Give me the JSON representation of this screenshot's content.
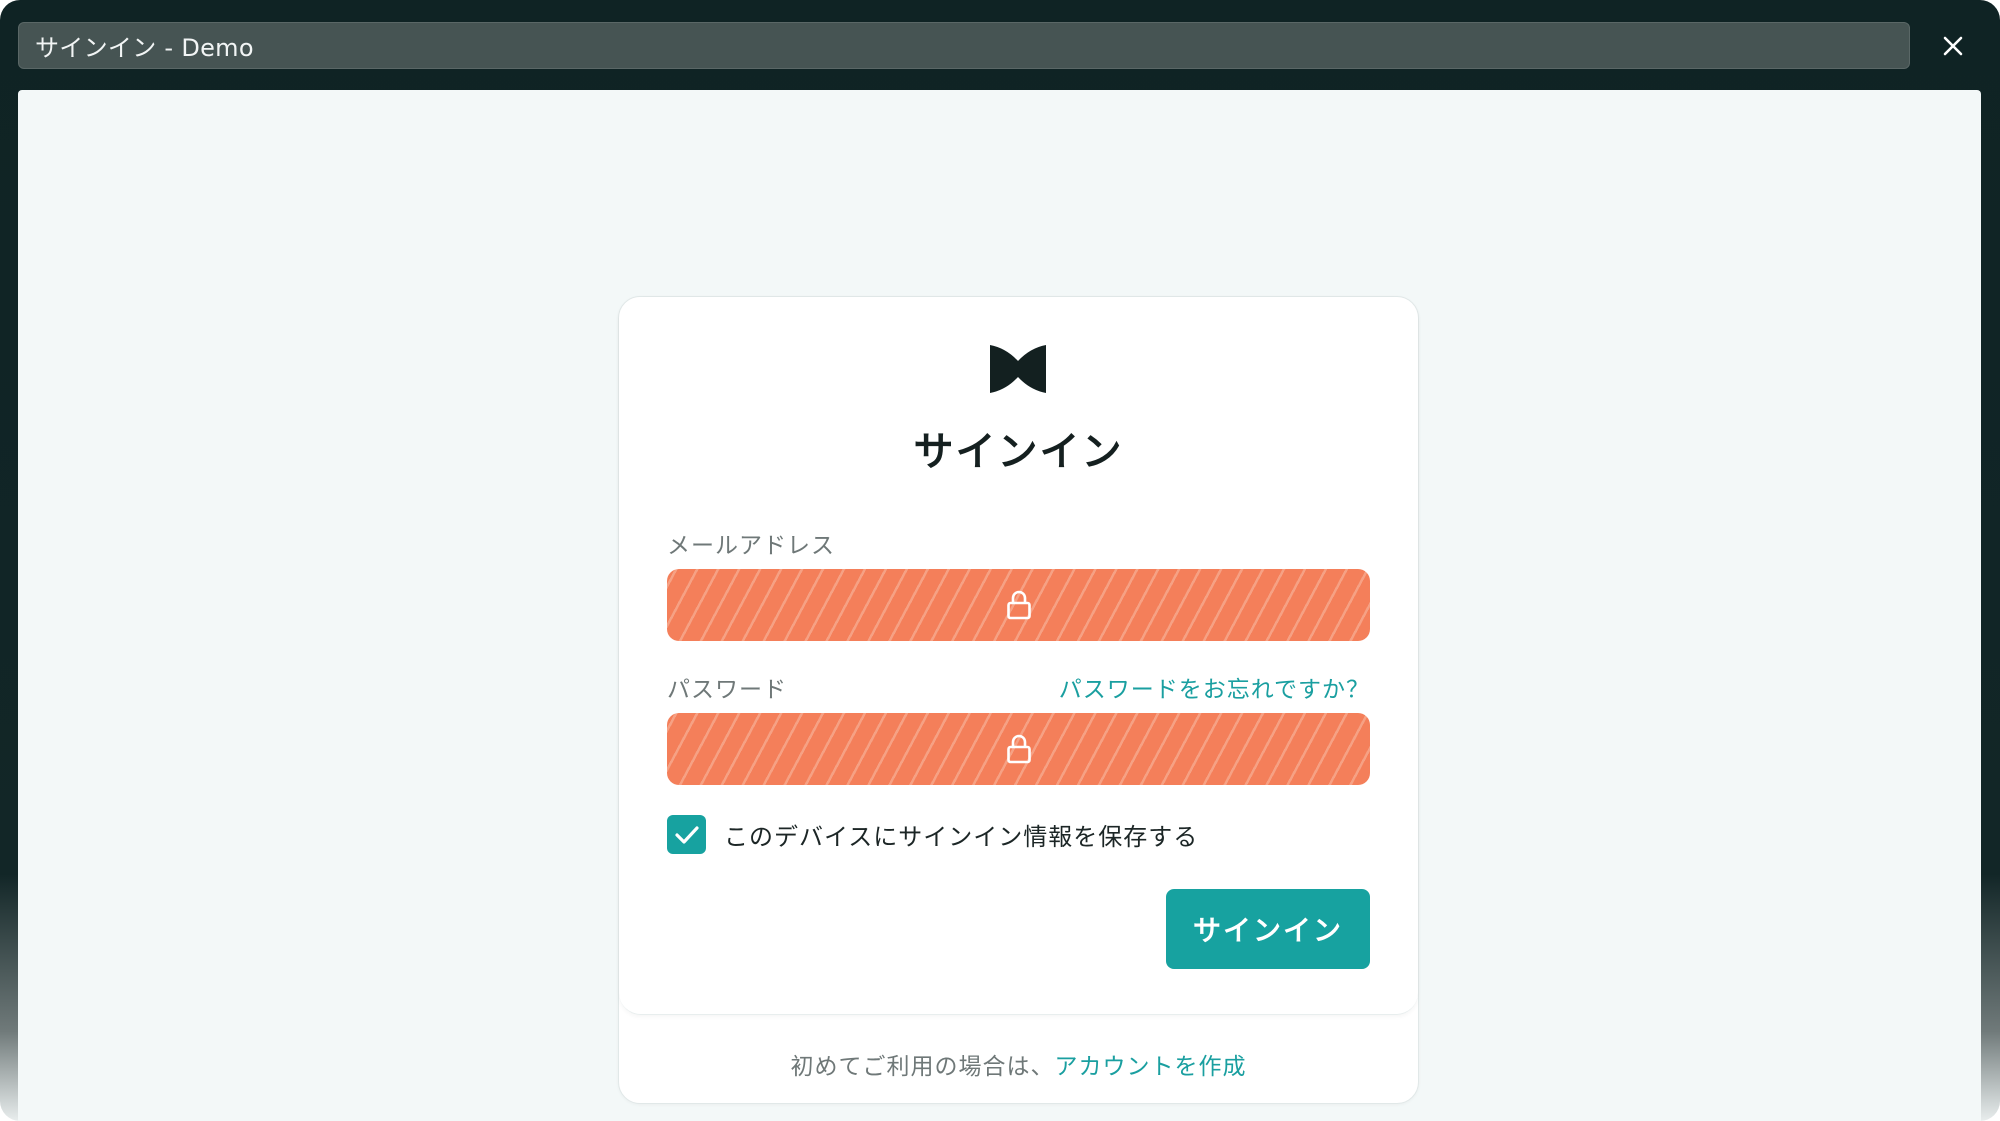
{
  "window": {
    "title": "サインイン - Demo"
  },
  "icons": {
    "close": "close-icon",
    "logo": "brand-logo",
    "lock": "lock-icon",
    "check": "checkmark-icon"
  },
  "colors": {
    "accent": "#17a2a0",
    "redaction": "#f47f5a",
    "heading": "#152020",
    "muted": "#6f7878"
  },
  "form": {
    "heading": "サインイン",
    "email_label": "メールアドレス",
    "password_label": "パスワード",
    "forgot_link": "パスワードをお忘れですか？",
    "remember_label": "このデバイスにサインイン情報を保存する",
    "remember_checked": true,
    "submit_label": "サインイン"
  },
  "footer": {
    "text": "初めてご利用の場合は、",
    "link": "アカウントを作成"
  }
}
